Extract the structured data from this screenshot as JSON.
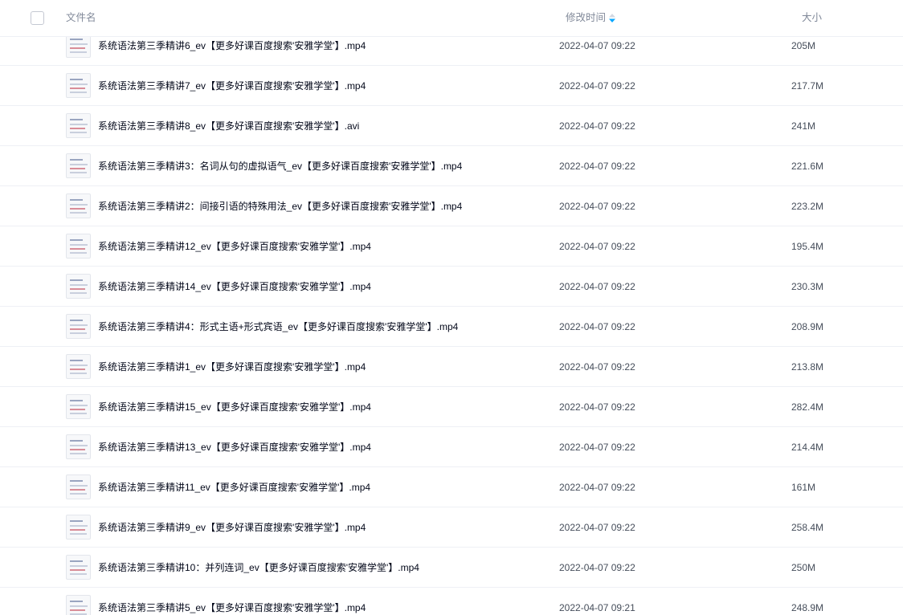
{
  "header": {
    "name_label": "文件名",
    "time_label": "修改时间",
    "size_label": "大小",
    "sort_icon": "sort-descending-icon",
    "accent": "#06a7ff"
  },
  "files": [
    {
      "name": "系统语法第三季精讲6_ev【更多好课百度搜索'安雅学堂'】.mp4",
      "time": "2022-04-07 09:22",
      "size": "205M"
    },
    {
      "name": "系统语法第三季精讲7_ev【更多好课百度搜索'安雅学堂'】.mp4",
      "time": "2022-04-07 09:22",
      "size": "217.7M"
    },
    {
      "name": "系统语法第三季精讲8_ev【更多好课百度搜索'安雅学堂'】.avi",
      "time": "2022-04-07 09:22",
      "size": "241M"
    },
    {
      "name": "系统语法第三季精讲3：名词从句的虚拟语气_ev【更多好课百度搜索'安雅学堂'】.mp4",
      "time": "2022-04-07 09:22",
      "size": "221.6M"
    },
    {
      "name": "系统语法第三季精讲2：间接引语的特殊用法_ev【更多好课百度搜索'安雅学堂'】.mp4",
      "time": "2022-04-07 09:22",
      "size": "223.2M"
    },
    {
      "name": "系统语法第三季精讲12_ev【更多好课百度搜索'安雅学堂'】.mp4",
      "time": "2022-04-07 09:22",
      "size": "195.4M"
    },
    {
      "name": "系统语法第三季精讲14_ev【更多好课百度搜索'安雅学堂'】.mp4",
      "time": "2022-04-07 09:22",
      "size": "230.3M"
    },
    {
      "name": "系统语法第三季精讲4：形式主语+形式宾语_ev【更多好课百度搜索'安雅学堂'】.mp4",
      "time": "2022-04-07 09:22",
      "size": "208.9M"
    },
    {
      "name": "系统语法第三季精讲1_ev【更多好课百度搜索'安雅学堂'】.mp4",
      "time": "2022-04-07 09:22",
      "size": "213.8M"
    },
    {
      "name": "系统语法第三季精讲15_ev【更多好课百度搜索'安雅学堂'】.mp4",
      "time": "2022-04-07 09:22",
      "size": "282.4M"
    },
    {
      "name": "系统语法第三季精讲13_ev【更多好课百度搜索'安雅学堂'】.mp4",
      "time": "2022-04-07 09:22",
      "size": "214.4M"
    },
    {
      "name": "系统语法第三季精讲11_ev【更多好课百度搜索'安雅学堂'】.mp4",
      "time": "2022-04-07 09:22",
      "size": "161M"
    },
    {
      "name": "系统语法第三季精讲9_ev【更多好课百度搜索'安雅学堂'】.mp4",
      "time": "2022-04-07 09:22",
      "size": "258.4M"
    },
    {
      "name": "系统语法第三季精讲10：并列连词_ev【更多好课百度搜索'安雅学堂'】.mp4",
      "time": "2022-04-07 09:22",
      "size": "250M"
    },
    {
      "name": "系统语法第三季精讲5_ev【更多好课百度搜索'安雅学堂'】.mp4",
      "time": "2022-04-07 09:21",
      "size": "248.9M"
    }
  ]
}
